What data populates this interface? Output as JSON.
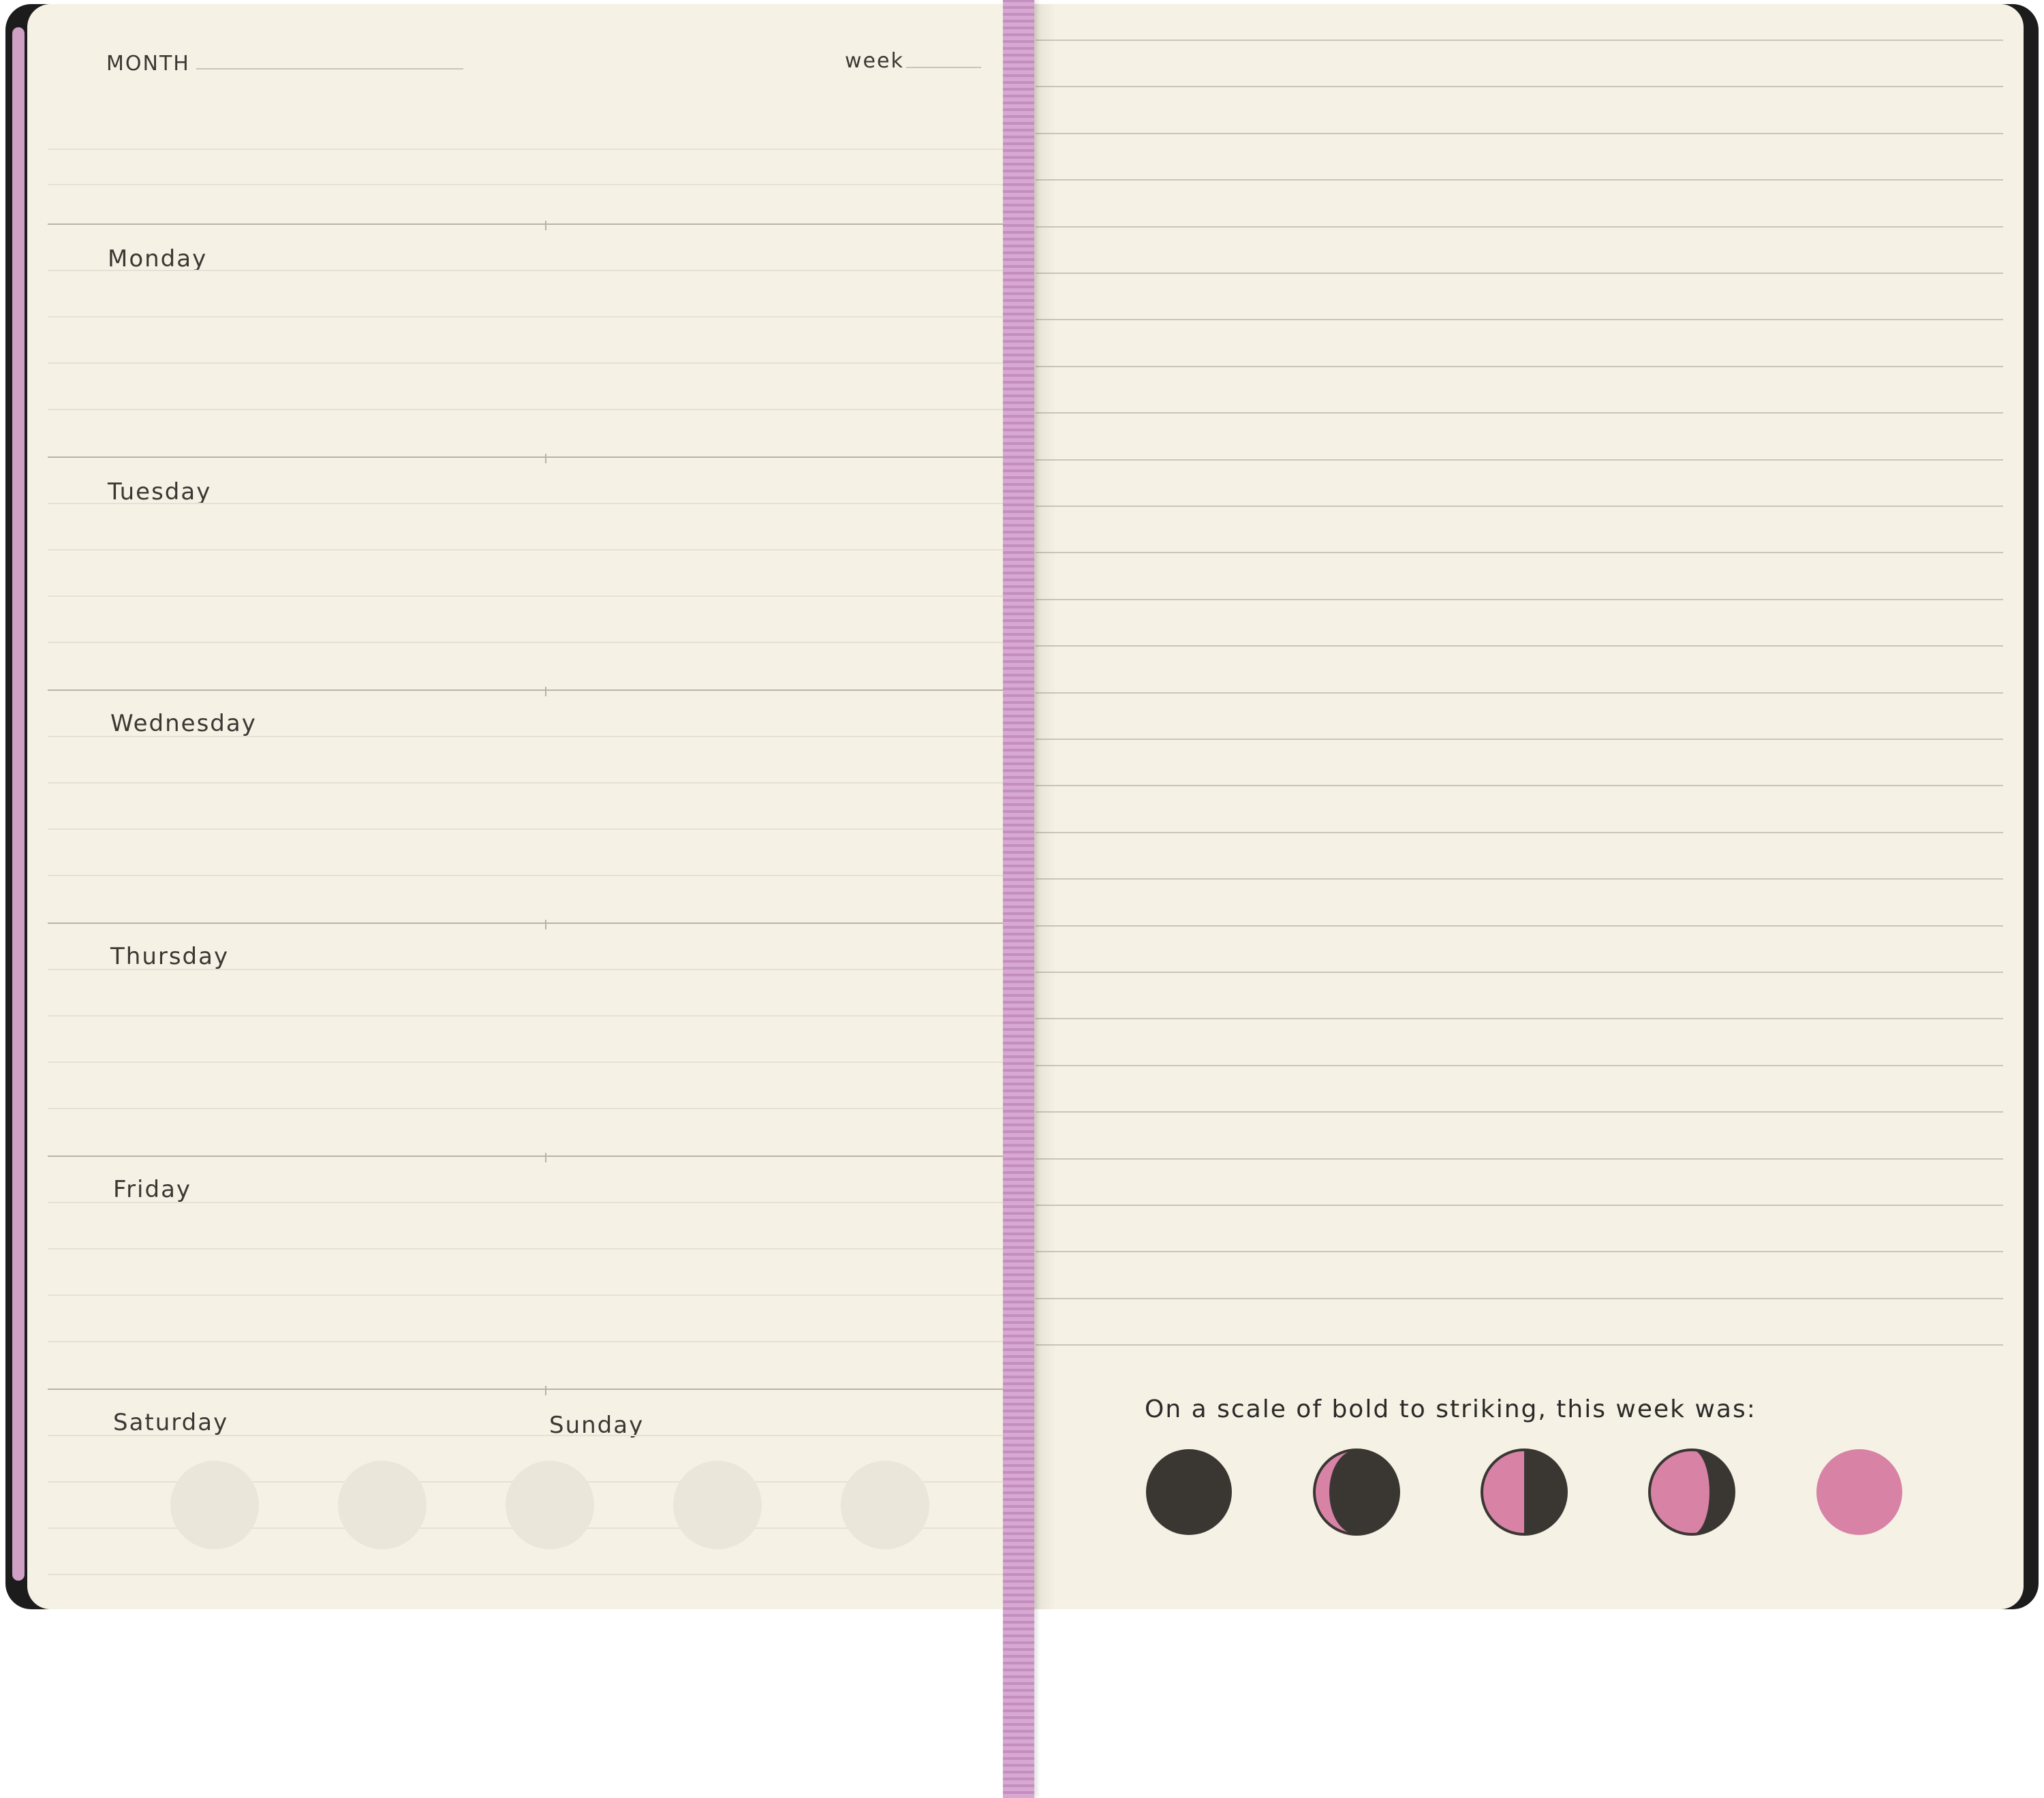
{
  "planner": {
    "month_label": "MONTH",
    "week_label": "week",
    "days": [
      "Monday",
      "Tuesday",
      "Wednesday",
      "Thursday",
      "Friday",
      "Saturday",
      "Sunday"
    ],
    "scale_prompt": "On a scale of bold to striking, this week was:",
    "mood_scale": [
      {
        "icon": "new-moon-icon",
        "pink_fraction": 0
      },
      {
        "icon": "waxing-crescent-icon",
        "pink_fraction": 0.25
      },
      {
        "icon": "half-moon-icon",
        "pink_fraction": 0.5
      },
      {
        "icon": "waxing-gibbous-icon",
        "pink_fraction": 0.75
      },
      {
        "icon": "full-moon-icon",
        "pink_fraction": 1
      }
    ]
  },
  "colors": {
    "page": "#f5f1e5",
    "cover": "#1d1c1c",
    "ribbon": "#d6a8d2",
    "moon_dark": "#3a3733",
    "moon_pink": "#d882a6"
  }
}
